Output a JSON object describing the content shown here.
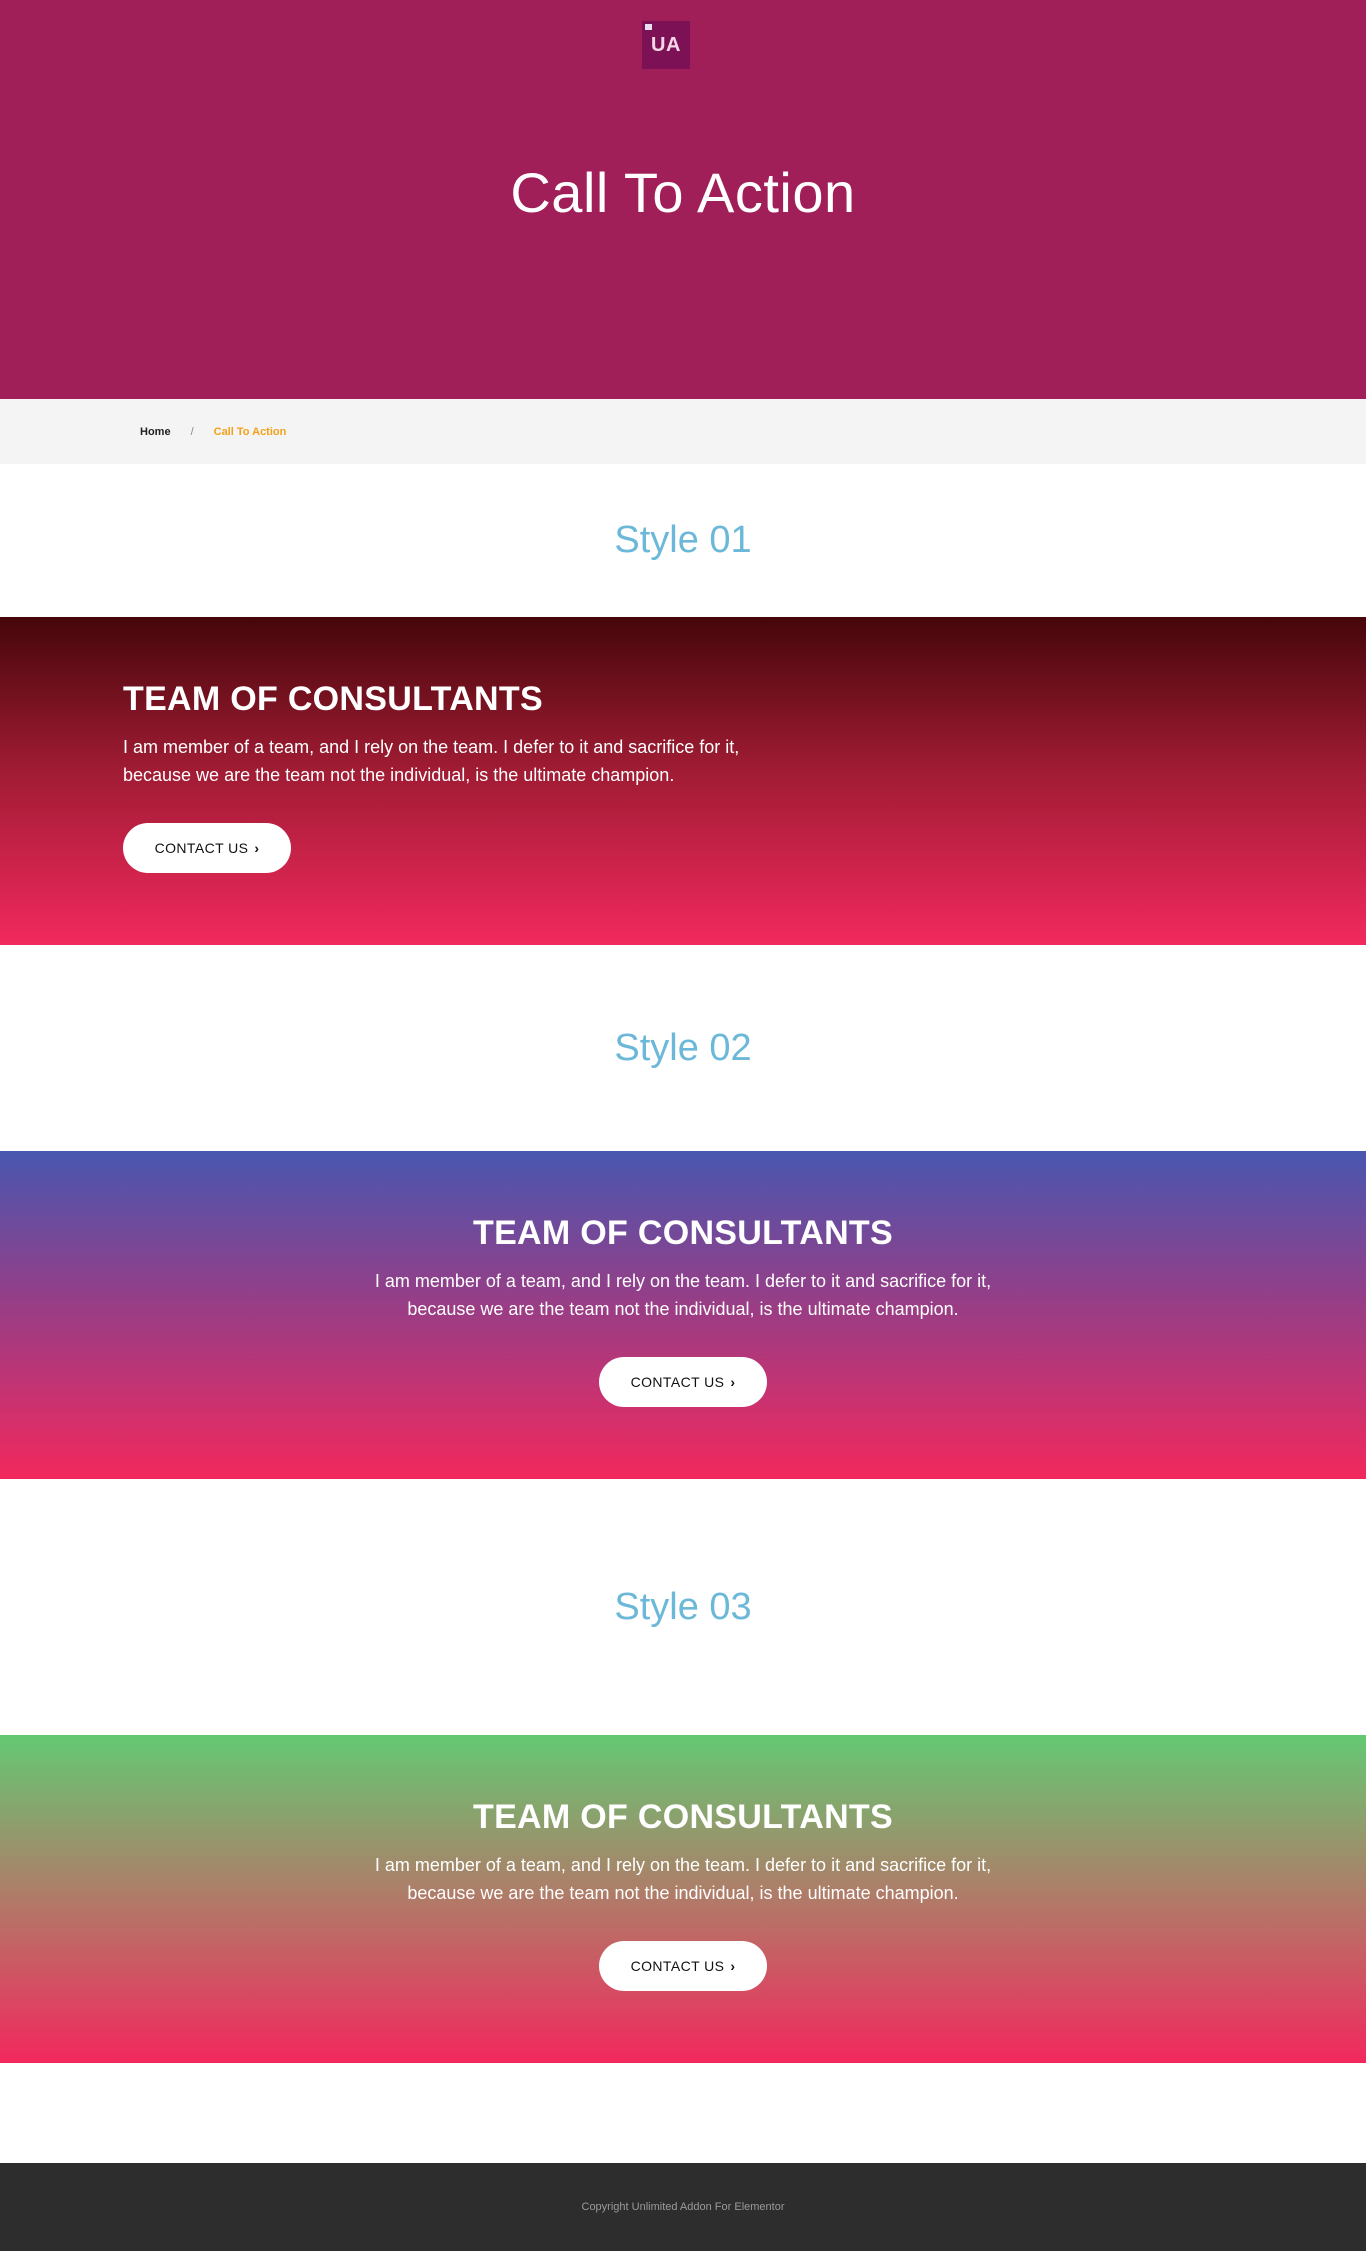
{
  "header": {
    "logo_text": "UA",
    "title": "Call To Action"
  },
  "breadcrumb": {
    "home": "Home",
    "separator": "/",
    "current": "Call To Action"
  },
  "sections": [
    {
      "heading": "Style 01",
      "cta": {
        "title": "TEAM OF CONSULTANTS",
        "text": "I am member of a team, and I rely on the team. I defer to it and sacrifice for it, because we are the team not the individual, is the ultimate champion.",
        "button_label": "CONTACT US",
        "button_icon": "chevron-right-icon"
      }
    },
    {
      "heading": "Style 02",
      "cta": {
        "title": "TEAM OF CONSULTANTS",
        "text": "I am member of a team, and I rely on the team. I defer to it and sacrifice for it, because we are the team not the individual, is the ultimate champion.",
        "button_label": "CONTACT US",
        "button_icon": "chevron-right-icon"
      }
    },
    {
      "heading": "Style 03",
      "cta": {
        "title": "TEAM OF CONSULTANTS",
        "text": "I am member of a team, and I rely on the team. I defer to it and sacrifice for it, because we are the team not the individual, is the ultimate champion.",
        "button_label": "CONTACT US",
        "button_icon": "chevron-right-icon"
      }
    }
  ],
  "footer": {
    "copyright": "Copyright Unlimited Addon For Elementor"
  },
  "colors": {
    "hero_bg": "#a01f58",
    "accent_orange": "#f2a11a",
    "style_heading": "#6cb8d9",
    "footer_bg": "#2d2d2d"
  }
}
